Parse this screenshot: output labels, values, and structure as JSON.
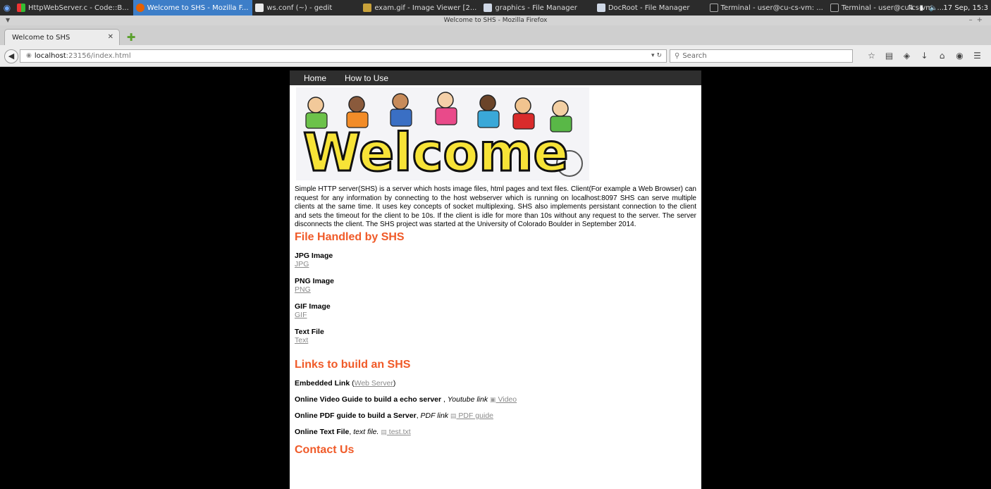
{
  "taskbar": {
    "tasks": [
      {
        "label": "HttpWebServer.c - Code::B..."
      },
      {
        "label": "Welcome to SHS - Mozilla F..."
      },
      {
        "label": "ws.conf (~) - gedit"
      },
      {
        "label": "exam.gif - Image Viewer [2..."
      },
      {
        "label": "graphics - File Manager"
      },
      {
        "label": "DocRoot - File Manager"
      },
      {
        "label": "Terminal - user@cu-cs-vm: ..."
      },
      {
        "label": "Terminal - user@cu-cs-vm: ..."
      }
    ],
    "clock": "17 Sep, 15:3"
  },
  "browser": {
    "window_title": "Welcome to SHS - Mozilla Firefox",
    "tab_title": "Welcome to SHS",
    "url_host": "localhost",
    "url_path": ":23156/index.html",
    "search_placeholder": "Search"
  },
  "site": {
    "nav": [
      "Home",
      "How to Use"
    ],
    "banner_text": "Welcome",
    "intro": "Simple HTTP server(SHS) is a server which hosts image files, html pages and text files. Client(For example a Web Browser) can request for any information by connecting to the host webserver which is running on localhost:8097 SHS can serve multiple clients at the same time. It uses key concepts of socket multiplexing. SHS also implements persistant connection to the client and sets the timeout for the client to be 10s. If the client is idle for more than 10s without any request to the server. The server disconnects the client. The SHS project was started at the University of Colorado Boulder in September 2014.",
    "files_heading": "File Handled by SHS",
    "files": [
      {
        "title": "JPG Image",
        "link": "JPG"
      },
      {
        "title": "PNG Image",
        "link": "PNG"
      },
      {
        "title": "GIF Image",
        "link": "GIF"
      },
      {
        "title": "Text File",
        "link": "Text"
      }
    ],
    "links_heading": "Links to build an SHS",
    "embedded": {
      "title": "Embedded Link",
      "open": " (",
      "link": "Web Server",
      "close": ")"
    },
    "video": {
      "title": "Online Video Guide to build a echo server",
      "sep": " , ",
      "desc": "Youtube link",
      "link": " Video"
    },
    "pdf": {
      "title": "Online PDF guide to build a Server",
      "sep": ", ",
      "desc": "PDF link",
      "link": " PDF guide"
    },
    "text": {
      "title": "Online Text File",
      "sep": ", ",
      "desc": "text file.",
      "link": " test.txt"
    },
    "contact_heading": "Contact Us"
  }
}
